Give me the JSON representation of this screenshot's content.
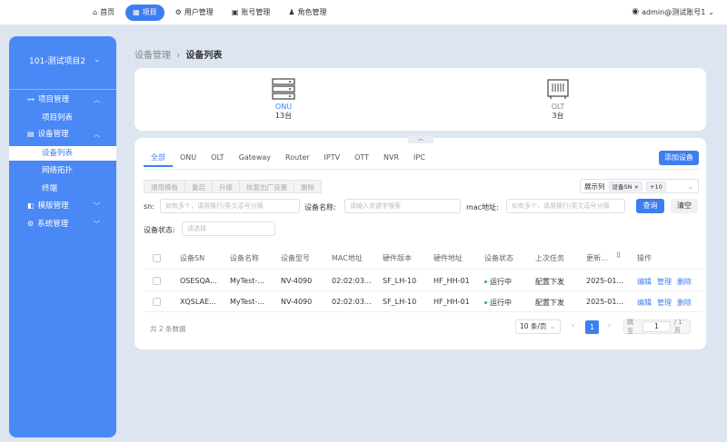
{
  "topnav": {
    "items": [
      {
        "label": "首页",
        "icon": "home-icon"
      },
      {
        "label": "项目",
        "icon": "grid-icon",
        "active": true
      },
      {
        "label": "用户管理",
        "icon": "gear-icon"
      },
      {
        "label": "账号管理",
        "icon": "account-icon"
      },
      {
        "label": "角色管理",
        "icon": "role-icon"
      }
    ],
    "user": "admin@测试账号1"
  },
  "sidebar": {
    "project": "101-测试项目2",
    "groups": [
      {
        "label": "项目管理",
        "sub": [
          "项目列表"
        ]
      },
      {
        "label": "设备管理",
        "sub": [
          "设备列表",
          "网络拓扑",
          "终端"
        ]
      },
      {
        "label": "模版管理",
        "sub": []
      },
      {
        "label": "系统管理",
        "sub": []
      }
    ],
    "active_sub": "设备列表"
  },
  "breadcrumb": {
    "parent": "设备管理",
    "sep": "›",
    "current": "设备列表"
  },
  "summary": {
    "onu": {
      "label": "ONU",
      "count": "13台"
    },
    "olt": {
      "label": "OLT",
      "count": "3台"
    }
  },
  "tabs": [
    "全部",
    "ONU",
    "OLT",
    "Gateway",
    "Router",
    "IPTV",
    "OTT",
    "NVR",
    "IPC"
  ],
  "add_button": "添加设备",
  "toolbar": [
    "通用模板",
    "重启",
    "升级",
    "恢复出厂设置",
    "删除"
  ],
  "column_selector": {
    "label": "展示列",
    "tag": "设备SN",
    "more": "+10"
  },
  "filters": {
    "sn_label": "sn:",
    "sn_placeholder": "如有多个，请用换行/英文逗号分隔",
    "name_label": "设备名称:",
    "name_placeholder": "请输入关键字搜索",
    "mac_label": "mac地址:",
    "mac_placeholder": "如有多个，请用换行/英文逗号分隔",
    "status_label": "设备状态:",
    "status_placeholder": "请选择",
    "query": "查询",
    "reset": "清空"
  },
  "table": {
    "headers": [
      "设备SN",
      "设备名称",
      "设备型号",
      "MAC地址",
      "硬件版本",
      "硬件地址",
      "设备状态",
      "上次任务",
      "更新...",
      "操作"
    ],
    "rows": [
      {
        "sn": "OSESQA...",
        "name": "MyTest-...",
        "model": "NV-4090",
        "mac": "02:02:03...",
        "sw": "SF_LH-10",
        "hw": "HF_HH-01",
        "status": "运行中",
        "task": "配置下发",
        "updated": "2025-01...",
        "ops": [
          "编辑",
          "管理",
          "删除"
        ]
      },
      {
        "sn": "XQSLAE...",
        "name": "MyTest-...",
        "model": "NV-4090",
        "mac": "02:02:03...",
        "sw": "SF_LH-10",
        "hw": "HF_HH-01",
        "status": "运行中",
        "task": "配置下发",
        "updated": "2025-01...",
        "ops": [
          "编辑",
          "管理",
          "删除"
        ]
      }
    ]
  },
  "pager": {
    "total": "共 2 条数据",
    "size": "10 条/页",
    "page": "1",
    "jump_label": "跳至",
    "jump_value": "1",
    "pages": "/ 1 页"
  }
}
